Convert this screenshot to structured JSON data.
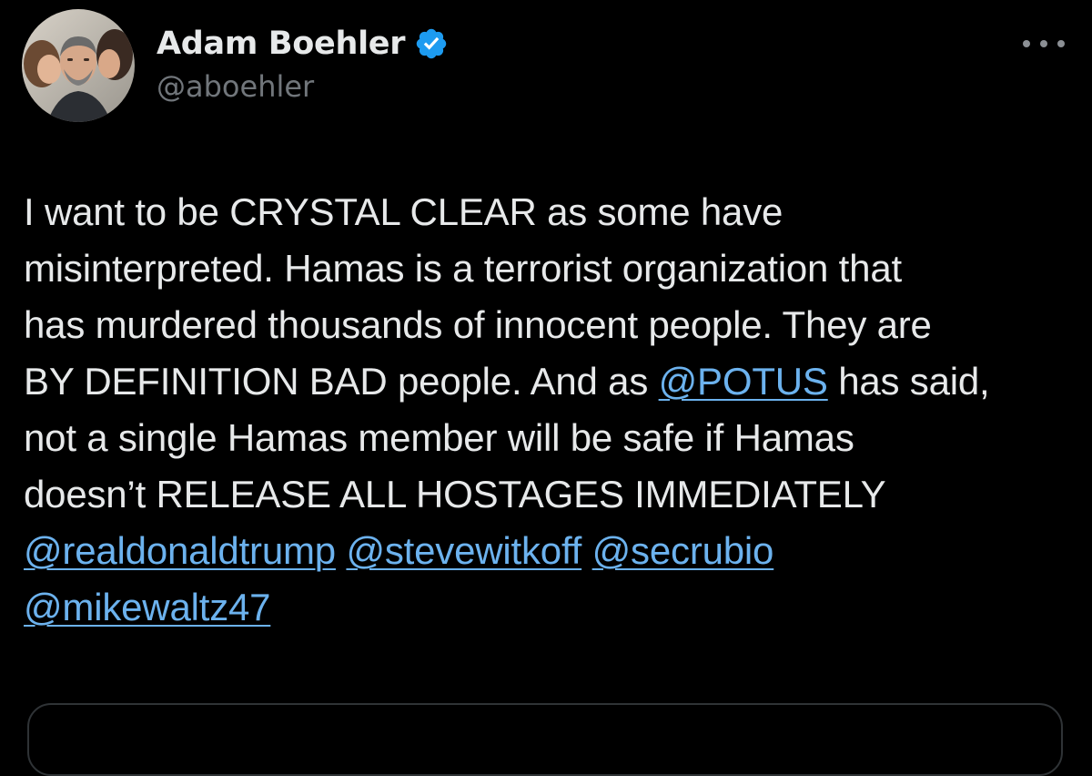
{
  "author": {
    "display_name": "Adam Boehler",
    "handle": "@aboehler",
    "verified": true,
    "avatar_icon": "avatar-photo"
  },
  "menu": {
    "icon": "more-options-icon"
  },
  "post": {
    "line1": "I want to be CRYSTAL CLEAR as some have",
    "line2": "misinterpreted. Hamas is a terrorist organization that",
    "line3": "has murdered thousands of innocent people. They are",
    "line4_before": "BY DEFINITION BAD people. And as ",
    "line4_mention": "@POTUS",
    "line4_after": " has said,",
    "line5": "not a single Hamas member will be safe if Hamas",
    "line6": "doesn’t RELEASE ALL HOSTAGES IMMEDIATELY",
    "mentions": [
      "@realdonaldtrump",
      "@stevewitkoff",
      "@secrubio",
      "@mikewaltz47"
    ]
  },
  "colors": {
    "background": "#000000",
    "text": "#e7e9ea",
    "secondary_text": "#71767b",
    "link": "#6cb2ee",
    "verified_badge": "#1d9bf0"
  }
}
